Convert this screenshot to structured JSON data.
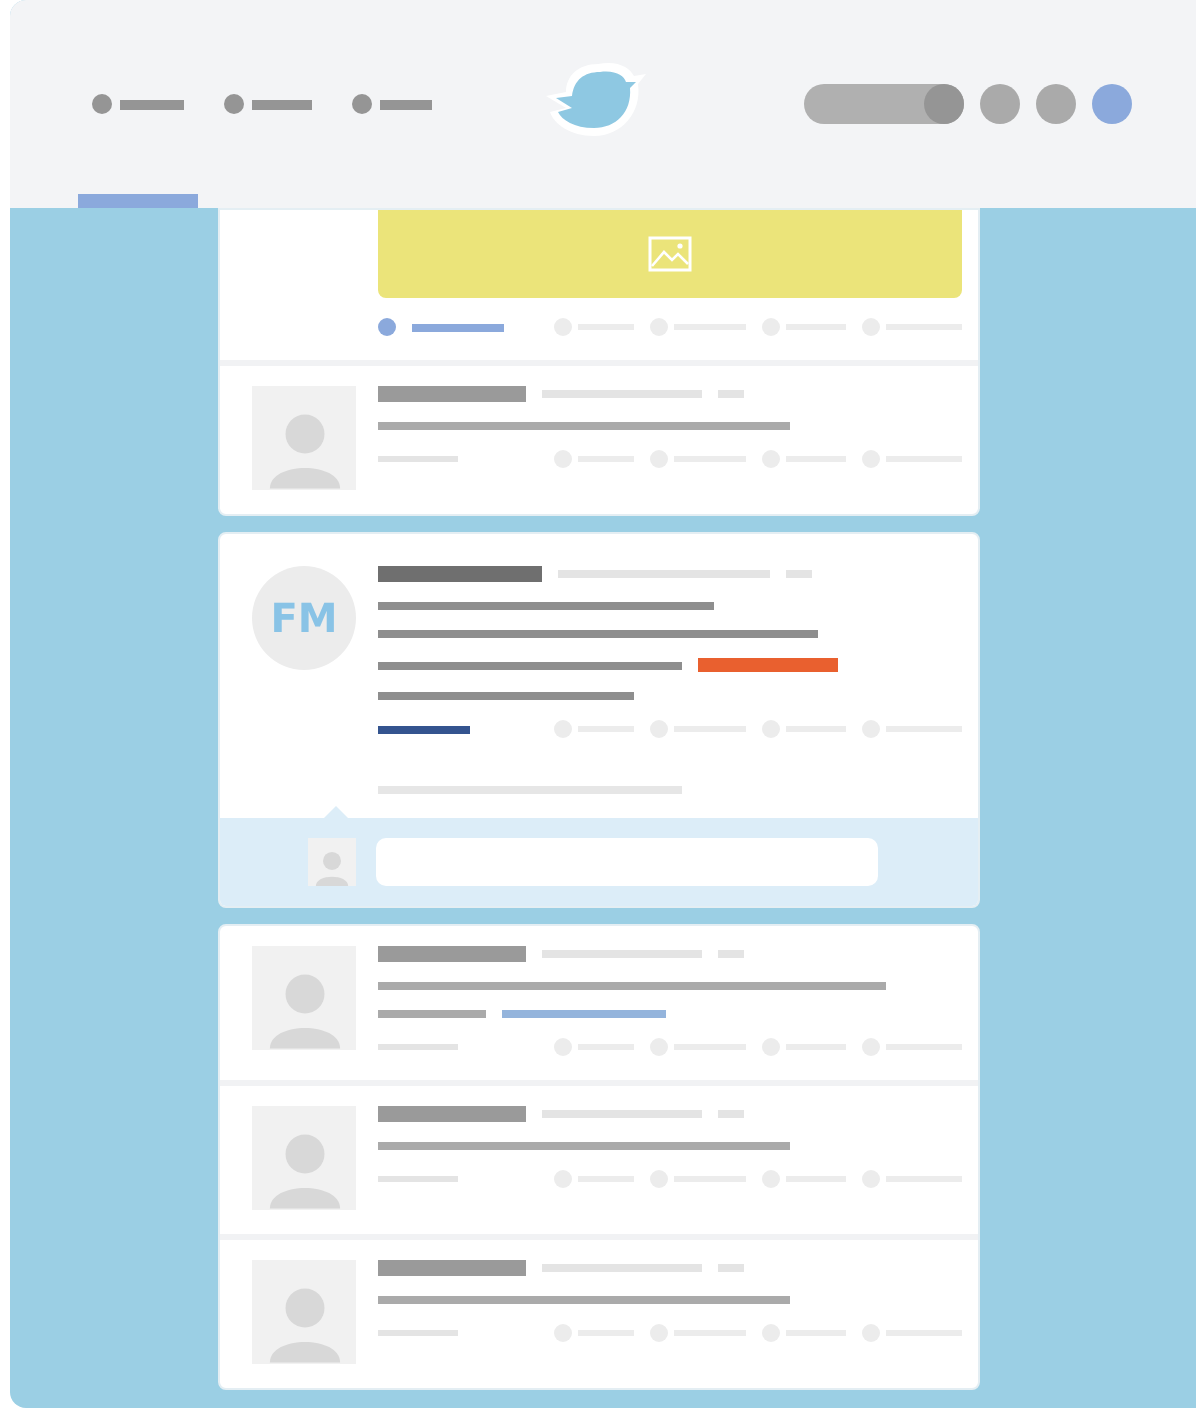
{
  "nav": [
    {
      "selected": true
    },
    {
      "selected": false
    },
    {
      "selected": false
    }
  ],
  "cards": [
    {
      "tweets": [
        {
          "kind": "media"
        },
        {
          "kind": "plain"
        }
      ]
    },
    {
      "tweets": [
        {
          "kind": "featured",
          "initials": "FM"
        }
      ]
    },
    {
      "tweets": [
        {
          "kind": "link"
        },
        {
          "kind": "plain"
        },
        {
          "kind": "plain"
        }
      ]
    }
  ]
}
